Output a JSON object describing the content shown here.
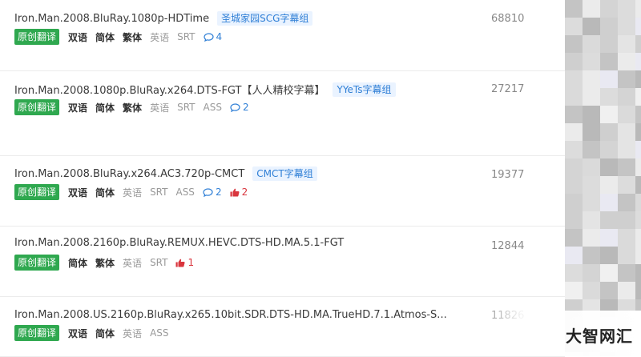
{
  "releases": [
    {
      "name": "Iron.Man.2008.BluRay.1080p-HDTime",
      "group": "圣城家园SCG字幕组",
      "count": "68810",
      "badge": "原创翻译",
      "langs_bold": [
        "双语",
        "简体",
        "繁体"
      ],
      "langs_light": [
        "英语"
      ],
      "formats": [
        "SRT"
      ],
      "comments": "4",
      "likes": null
    },
    {
      "name": "Iron.Man.2008.1080p.BluRay.x264.DTS-FGT【人人精校字幕】",
      "group": "YYeTs字幕组",
      "count": "27217",
      "badge": "原创翻译",
      "langs_bold": [
        "双语",
        "简体",
        "繁体"
      ],
      "langs_light": [
        "英语"
      ],
      "formats": [
        "SRT",
        "ASS"
      ],
      "comments": "2",
      "likes": null
    },
    {
      "name": "Iron.Man.2008.BluRay.x264.AC3.720p-CMCT",
      "group": "CMCT字幕组",
      "count": "19377",
      "badge": "原创翻译",
      "langs_bold": [
        "双语",
        "简体"
      ],
      "langs_light": [
        "英语"
      ],
      "formats": [
        "SRT",
        "ASS"
      ],
      "comments": "2",
      "likes": "2"
    },
    {
      "name": "Iron.Man.2008.2160p.BluRay.REMUX.HEVC.DTS-HD.MA.5.1-FGT",
      "group": null,
      "count": "12844",
      "badge": "原创翻译",
      "langs_bold": [
        "简体",
        "繁体"
      ],
      "langs_light": [
        "英语"
      ],
      "formats": [
        "SRT"
      ],
      "comments": null,
      "likes": "1"
    },
    {
      "name": "Iron.Man.2008.US.2160p.BluRay.x265.10bit.SDR.DTS-HD.MA.TrueHD.7.1.Atmos-S...",
      "group": null,
      "count": "11826",
      "badge": "原创翻译",
      "langs_bold": [
        "双语",
        "简体"
      ],
      "langs_light": [
        "英语"
      ],
      "formats": [
        "ASS"
      ],
      "comments": null,
      "likes": null
    }
  ],
  "icons": {
    "comment": "comment-icon",
    "like": "thumbs-up-icon"
  },
  "colors": {
    "badge_bg": "#2fa84f",
    "group_text": "#2f7fd6",
    "group_bg": "#eaf3ff",
    "comment": "#2f7fd6",
    "like": "#d9363e"
  },
  "watermark": "大智网汇"
}
